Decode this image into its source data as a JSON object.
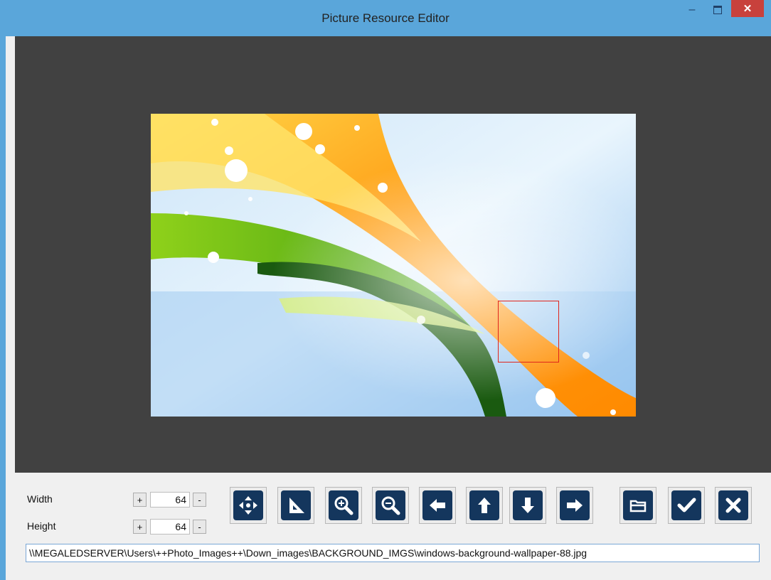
{
  "window": {
    "title": "Picture Resource Editor",
    "minimize_glyph": "–",
    "close_glyph": "✕"
  },
  "colors": {
    "titlebar": "#5aa6da",
    "canvas": "#414141",
    "tool_button": "#14365d",
    "selection": "#e0241b",
    "close": "#c8413c"
  },
  "size": {
    "width_label": "Width",
    "height_label": "Height",
    "width_value": "64",
    "height_value": "64",
    "plus": "+",
    "minus": "-"
  },
  "tools": [
    {
      "name": "move-icon"
    },
    {
      "name": "set-square-icon"
    },
    {
      "name": "zoom-in-icon"
    },
    {
      "name": "zoom-out-icon"
    },
    {
      "name": "arrow-left-icon"
    },
    {
      "name": "arrow-up-icon"
    },
    {
      "name": "arrow-down-icon"
    },
    {
      "name": "arrow-right-icon"
    },
    {
      "name": "open-folder-icon"
    },
    {
      "name": "check-icon"
    },
    {
      "name": "close-icon"
    }
  ],
  "file_path": "\\\\MEGALEDSERVER\\Users\\++Photo_Images++\\Down_images\\BACKGROUND_IMGS\\windows-background-wallpaper-88.jpg"
}
